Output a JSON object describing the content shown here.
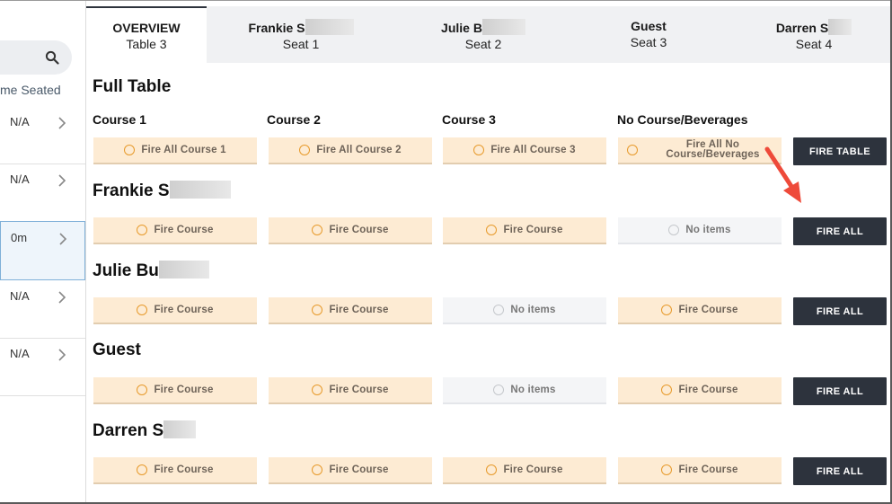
{
  "sidebar": {
    "sort_label": "me Seated",
    "rows": [
      {
        "value": "N/A"
      },
      {
        "value": "N/A"
      },
      {
        "value": "0m"
      },
      {
        "value": "N/A"
      },
      {
        "value": "N/A"
      }
    ]
  },
  "tabs": [
    {
      "name": "OVERVIEW",
      "seat": "Table 3"
    },
    {
      "name": "Frankie S",
      "seat": "Seat 1"
    },
    {
      "name": "Julie B",
      "seat": "Seat 2"
    },
    {
      "name": "Guest",
      "seat": "Seat 3"
    },
    {
      "name": "Darren S",
      "seat": "Seat 4"
    }
  ],
  "full_table": {
    "title": "Full Table",
    "columns": [
      "Course 1",
      "Course 2",
      "Course 3",
      "No Course/Beverages"
    ],
    "buttons": [
      "Fire All Course 1",
      "Fire All Course 2",
      "Fire All Course 3"
    ],
    "beverage_button_line1": "Fire All No",
    "beverage_button_line2": "Course/Beverages",
    "fire_table_label": "FIRE TABLE"
  },
  "guests": [
    {
      "name": "Frankie S",
      "buttons": [
        "Fire Course",
        "Fire Course",
        "Fire Course",
        "No items"
      ],
      "fire_all": "FIRE ALL"
    },
    {
      "name": "Julie Bu",
      "buttons": [
        "Fire Course",
        "Fire Course",
        "No items",
        "Fire Course"
      ],
      "fire_all": "FIRE ALL"
    },
    {
      "name": "Guest",
      "buttons": [
        "Fire Course",
        "Fire Course",
        "No items",
        "Fire Course"
      ],
      "fire_all": "FIRE ALL"
    },
    {
      "name": "Darren S",
      "buttons": [
        "Fire Course",
        "Fire Course",
        "Fire Course",
        "Fire Course"
      ],
      "fire_all": "FIRE ALL"
    }
  ],
  "colors": {
    "accent_dark": "#2d333d",
    "course_bg": "#fdebd3",
    "arrow": "#ee4a3a"
  }
}
